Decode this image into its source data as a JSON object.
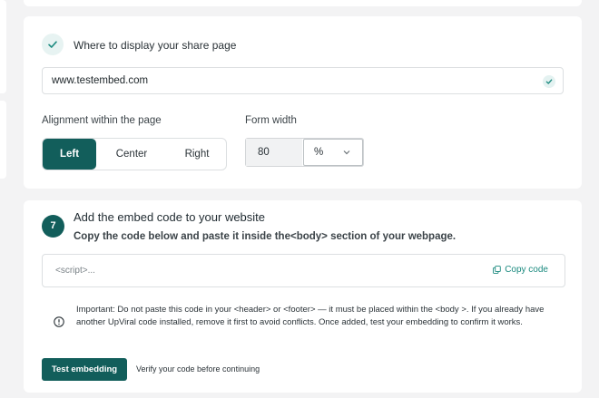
{
  "display_section": {
    "title": "Where to display your share page",
    "url_value": "www.testembed.com",
    "alignment_label": "Alignment within the page",
    "alignment_options": [
      "Left",
      "Center",
      "Right"
    ],
    "alignment_selected": "Left",
    "form_width_label": "Form width",
    "form_width_value": "80",
    "form_width_unit": "%"
  },
  "embed_section": {
    "step_number": "7",
    "title": "Add the embed code to your website",
    "subtitle": "Copy the code below and paste it inside the<body> section of your webpage.",
    "code_value": "<script>...",
    "copy_label": "Copy code",
    "important_text": "Important: Do not paste this code in your <header> or <footer> — it must be placed within the <body >. If you already have another UpViral code installed, remove it first to avoid conflicts. Once added, test your embedding to confirm it works.",
    "test_button_label": "Test embedding",
    "verify_text": "Verify your code before continuing"
  },
  "colors": {
    "accent": "#125e5b",
    "link": "#1b8a7f",
    "background": "#f3f3f4"
  },
  "icons": [
    "check-icon",
    "check-circle-icon",
    "chevron-down-icon",
    "copy-icon",
    "info-icon"
  ]
}
